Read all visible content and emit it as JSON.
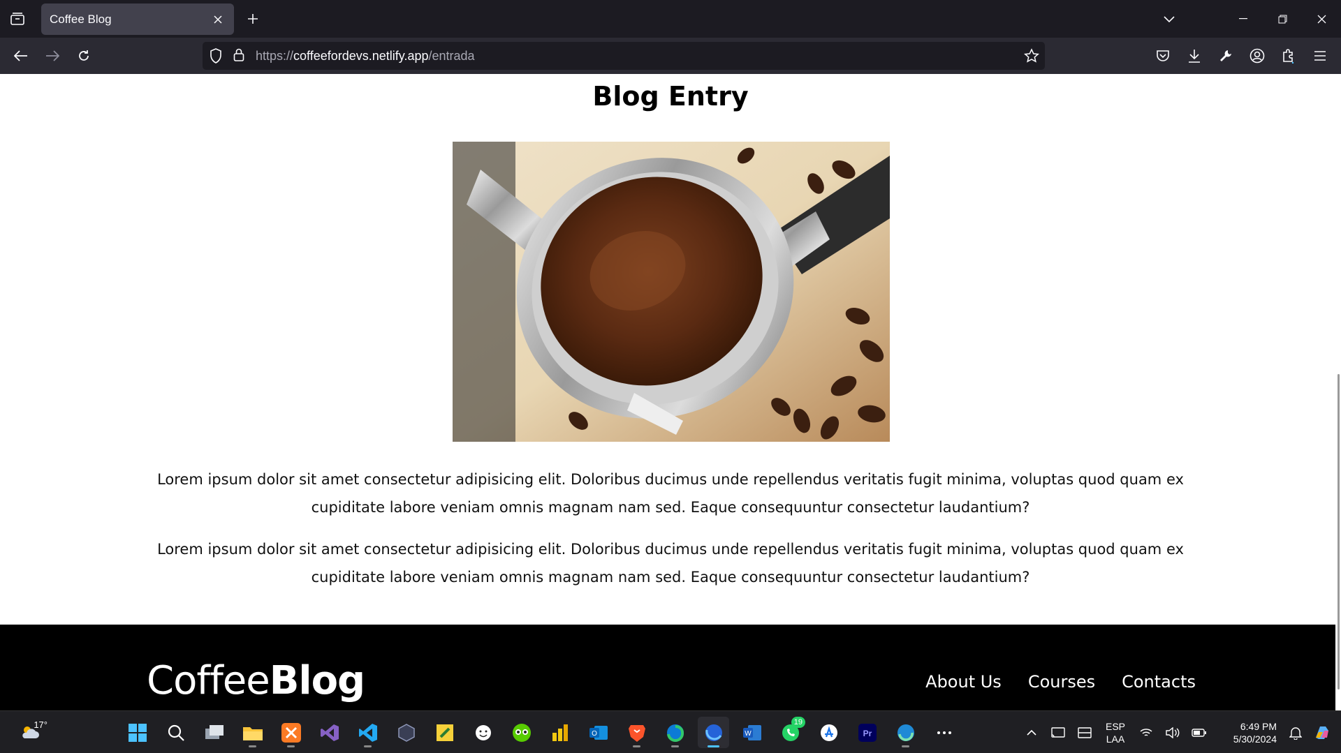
{
  "browser": {
    "tab_title": "Coffee Blog",
    "url_scheme": "https://",
    "url_host": "coffeefordevs.netlify.app",
    "url_path": "/entrada"
  },
  "page": {
    "title": "Blog Entry",
    "paragraphs": [
      "Lorem ipsum dolor sit amet consectetur adipisicing elit. Doloribus ducimus unde repellendus veritatis fugit minima, voluptas quod quam ex cupiditate labore veniam omnis magnam nam sed. Eaque consequuntur consectetur laudantium?",
      "Lorem ipsum dolor sit amet consectetur adipisicing elit. Doloribus ducimus unde repellendus veritatis fugit minima, voluptas quod quam ex cupiditate labore veniam omnis magnam nam sed. Eaque consequuntur consectetur laudantium?"
    ],
    "hero_image_icon": "coffee-portafilter-image"
  },
  "footer": {
    "logo_regular": "Coffee",
    "logo_bold": "Blog",
    "nav": [
      "About Us",
      "Courses",
      "Contacts"
    ]
  },
  "taskbar": {
    "weather_temp": "17°",
    "apps": [
      "start-icon",
      "search-icon",
      "task-view-icon",
      "file-explorer-icon",
      "xampp-icon",
      "visual-studio-icon",
      "vscode-icon",
      "app-icon",
      "sticky-notes-icon",
      "emoji-icon",
      "duolingo-icon",
      "power-bi-icon",
      "outlook-icon",
      "brave-icon",
      "edge-icon",
      "firefox-icon",
      "word-icon",
      "whatsapp-icon",
      "app-store-icon",
      "premiere-icon",
      "edge-dev-icon"
    ],
    "whatsapp_badge": "19",
    "language_line1": "ESP",
    "language_line2": "LAA",
    "time": "6:49 PM",
    "date": "5/30/2024"
  },
  "colors": {
    "tabbar": "#1c1b22",
    "navbar": "#2b2a33",
    "footer": "#000000",
    "accent": "#4cc2ff"
  }
}
